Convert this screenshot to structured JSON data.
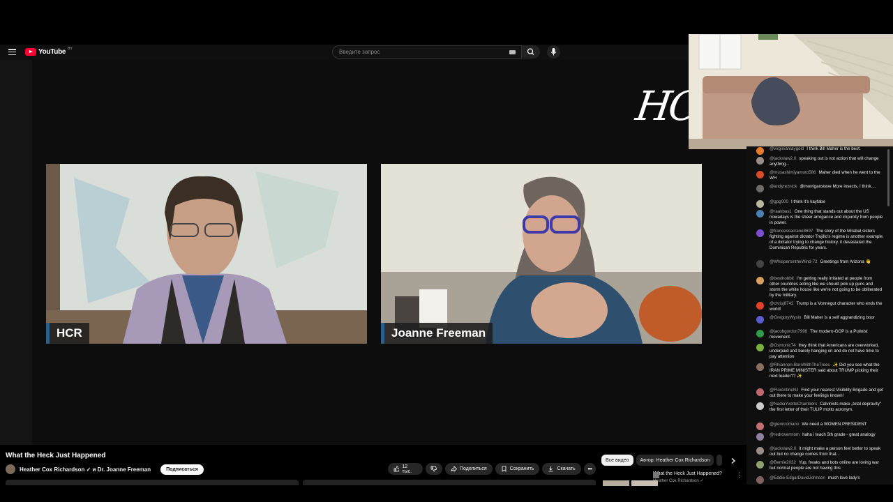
{
  "header": {
    "logo_text": "YouTube",
    "country_code": "BY",
    "search_placeholder": "Введите запрос"
  },
  "video": {
    "watermark": "HCR",
    "participants": [
      {
        "tag": "HCR"
      },
      {
        "tag": "Joanne Freeman"
      }
    ],
    "title": "What the Heck Just Happened",
    "channel_names": "Heather Cox Richardson ✓ и Dr. Joanne Freeman",
    "subscribe_label": "Подписаться"
  },
  "actions": {
    "likes": "12 тыс.",
    "share": "Поделиться",
    "save": "Сохранить",
    "download": "Скачать"
  },
  "chips": {
    "all": "Все видео",
    "author": "Автор: Heather Cox Richardson"
  },
  "recommendation": {
    "title": "What the Heck Just Happened?",
    "channel": "Heather Cox Richardson ✓"
  },
  "chat": {
    "messages": [
      {
        "user": "@virginiamaygold",
        "text": "I think Bill Maher is the best.",
        "color": "#e87c2a"
      },
      {
        "user": "@jackslaw2.0",
        "text": "speaking out is not action that will change anything...",
        "color": "#9a8f88"
      },
      {
        "user": "@musashimiyamoto586",
        "text": "Maher died when he went to the WH",
        "color": "#d84a2a"
      },
      {
        "user": "@andyreznick",
        "text": "@morrigansteve More insects, I think....",
        "color": "#6d6a6a"
      },
      {
        "user": "@gpg000",
        "text": "I think it's kayfabe",
        "color": "#b8b8a0"
      },
      {
        "user": "@raakbas1",
        "text": "One thing that stands out about the US nowadays is the sheer arrogance and impunity from people in power.",
        "color": "#4b7fb0"
      },
      {
        "user": "@francescacrane8697",
        "text": "The story of the Mirabal sisters fighting against dictator Trujillo's regime is another example of a dictator trying to change history. it devastated the Dominican Republic for years.",
        "color": "#7b4fcf"
      },
      {
        "user": "@WhispersintheWind-72",
        "text": "Greetings from Arizona 👋",
        "color": "#444444"
      },
      {
        "user": "@besthobbit",
        "text": "I'm getting really irritated at people from other countries acting like we should pick up guns and storm the white house like we're not going to be obliterated by the military.",
        "color": "#d8a060"
      },
      {
        "user": "@chrisj8742",
        "text": "Trump is a Vonnegut character who ends the world!",
        "color": "#e8412a"
      },
      {
        "user": "@GregoryWysin",
        "text": "Bill Maher is a self aggrandizing boor",
        "color": "#5a5ad0"
      },
      {
        "user": "@jacobgordon7998",
        "text": "The modern-GOP is a Putinist movement.",
        "color": "#2e9a4a"
      },
      {
        "user": "@Osmonic74",
        "text": "they think that Americans are overworked, underpaid and barely hanging on and do not have time to pay attention",
        "color": "#7ab040"
      },
      {
        "user": "@Rhiannon-BornWithTheTrees",
        "text": "✨ Did you see what the IRAN PRIME MINISTER said about TRUMP picking their next leader?? ✨",
        "color": "#8a7060"
      },
      {
        "user": "@FlorentineNJ",
        "text": "Find your nearest Visibility Brigade and get out there to make your feelings known!",
        "color": "#c06a70"
      },
      {
        "user": "@NadiaYvetteChambers",
        "text": "Calvinists make „total depravity\" the first letter of their TULIP motto acronym.",
        "color": "#cccccc"
      },
      {
        "user": "@glennromano",
        "text": "We need a WOMEN PRESIDENT",
        "color": "#c07070"
      },
      {
        "user": "@redrovermom",
        "text": "haha i teach 5th grade - great analogy",
        "color": "#9080a0"
      },
      {
        "user": "@jackslaw2.0",
        "text": "it might make a person feel better to speak out but no change comes from that...",
        "color": "#9a8f88"
      },
      {
        "user": "@Bernie2032",
        "text": "Yup, freaks and bots online are loving war but normal people are not having this",
        "color": "#90a070"
      },
      {
        "user": "@Eddie-EdgarDavidJohnson",
        "text": "much love lady's",
        "color": "#806060"
      }
    ]
  }
}
